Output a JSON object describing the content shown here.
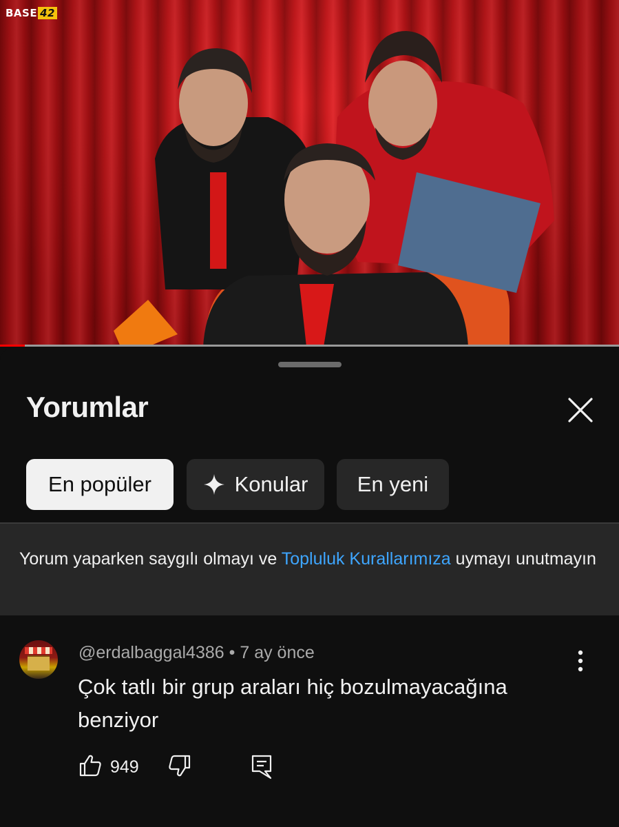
{
  "video": {
    "logo_text": "BASE",
    "logo_number": "42",
    "progress": 0.04,
    "colors": {
      "curtain": "#c81418",
      "progress": "#ff0000"
    }
  },
  "comments_panel": {
    "title": "Yorumlar",
    "close_icon": "close-icon",
    "chips": [
      {
        "label": "En popüler",
        "active": true
      },
      {
        "label": "Konular",
        "icon": "sparkle-icon",
        "active": false
      },
      {
        "label": "En yeni",
        "active": false
      }
    ],
    "notice": {
      "text_before": "Yorum yaparken saygılı olmayı ve ",
      "link": "Topluluk Kurallarımıza",
      "text_after": " uymayı unutmayın"
    },
    "comments": [
      {
        "author": "@erdalbaggal4386",
        "separator": "•",
        "time": "7 ay önce",
        "text": "Çok tatlı bir grup araları hiç bozulmayacağına benziyor",
        "likes": "949"
      }
    ]
  },
  "colors": {
    "background": "#0f0f0f",
    "chip": "#272727",
    "chip_active": "#f1f1f1",
    "link": "#3ea6ff",
    "secondary_text": "#aaaaaa"
  }
}
